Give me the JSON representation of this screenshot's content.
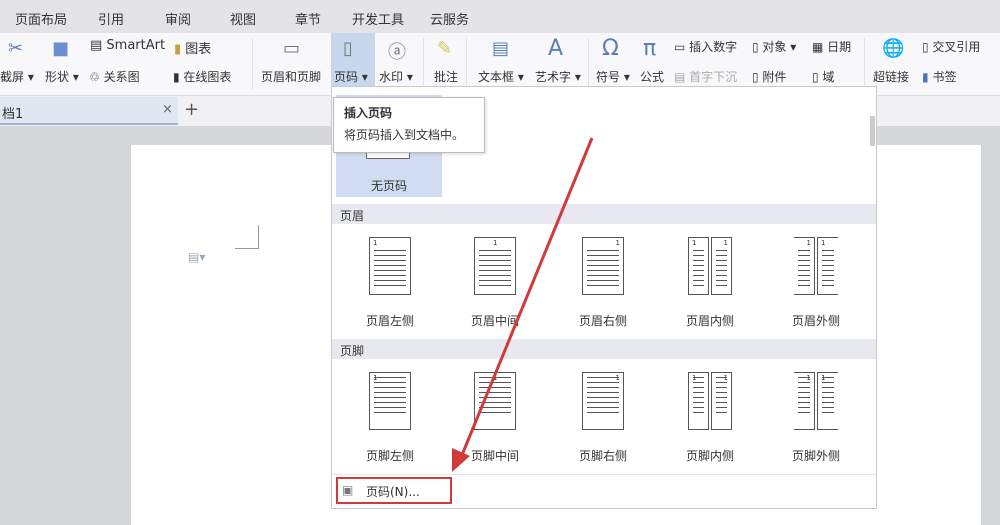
{
  "menu_tabs": [
    "页面布局",
    "引用",
    "审阅",
    "视图",
    "章节",
    "开发工具",
    "云服务"
  ],
  "ribbon": {
    "screenshot": "截屏",
    "shape": "形状",
    "smartart": "SmartArt",
    "chart": "图表",
    "relation": "关系图",
    "online_chart": "在线图表",
    "header_footer": "页眉和页脚",
    "page_number": "页码",
    "watermark": "水印",
    "comment": "批注",
    "textbox": "文本框",
    "wordart": "艺术字",
    "symbol": "符号",
    "formula": "公式",
    "insert_number": "插入数字",
    "drop_cap": "首字下沉",
    "object": "对象",
    "attachment": "附件",
    "date": "日期",
    "field": "域",
    "hyperlink": "超链接",
    "cross_ref": "交叉引用",
    "bookmark": "书签"
  },
  "doc_tab": {
    "title": "档1",
    "close": "×",
    "new": "+"
  },
  "tooltip": {
    "title": "插入页码",
    "desc": "将页码插入到文档中。"
  },
  "dropdown": {
    "none_label": "无页码",
    "header_section": "页眉",
    "header_items": [
      "页眉左侧",
      "页眉中间",
      "页眉右侧",
      "页眉内侧",
      "页眉外侧"
    ],
    "footer_section": "页脚",
    "footer_items": [
      "页脚左侧",
      "页脚中间",
      "页脚右侧",
      "页脚内侧",
      "页脚外侧"
    ],
    "page_num_item": "页码(N)...",
    "page_number_digit": "1"
  },
  "colors": {
    "highlight": "#cfdcf2",
    "arrow": "#d23a3a"
  }
}
